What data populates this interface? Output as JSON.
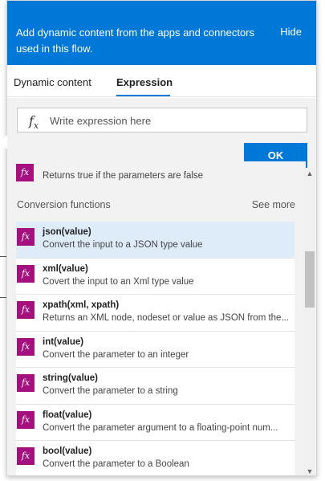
{
  "header": {
    "text": "Add dynamic content from the apps and connectors used in this flow.",
    "hide_label": "Hide"
  },
  "tabs": [
    {
      "label": "Dynamic content",
      "active": false
    },
    {
      "label": "Expression",
      "active": true
    }
  ],
  "expression": {
    "fx_symbol": "fx",
    "placeholder": "Write expression here",
    "value": "",
    "ok_label": "OK"
  },
  "previous_item": {
    "description": "Returns true if the parameters are false"
  },
  "section": {
    "title": "Conversion functions",
    "see_more": "See more"
  },
  "functions": [
    {
      "name": "json(value)",
      "description": "Convert the input to a JSON type value",
      "selected": true
    },
    {
      "name": "xml(value)",
      "description": "Covert the input to an Xml type value",
      "selected": false
    },
    {
      "name": "xpath(xml, xpath)",
      "description": "Returns an XML node, nodeset or value as JSON from the...",
      "selected": false
    },
    {
      "name": "int(value)",
      "description": "Convert the parameter to an integer",
      "selected": false
    },
    {
      "name": "string(value)",
      "description": "Convert the parameter to a string",
      "selected": false
    },
    {
      "name": "float(value)",
      "description": "Convert the parameter argument to a floating-point num...",
      "selected": false
    },
    {
      "name": "bool(value)",
      "description": "Convert the parameter to a Boolean",
      "selected": false
    }
  ],
  "colors": {
    "accent": "#0078d7",
    "function_icon": "#a4117f",
    "selected_row": "#deecf9"
  },
  "icons": {
    "function": "function-icon",
    "scroll_up": "chevron-up-icon",
    "scroll_down": "chevron-down-icon"
  }
}
